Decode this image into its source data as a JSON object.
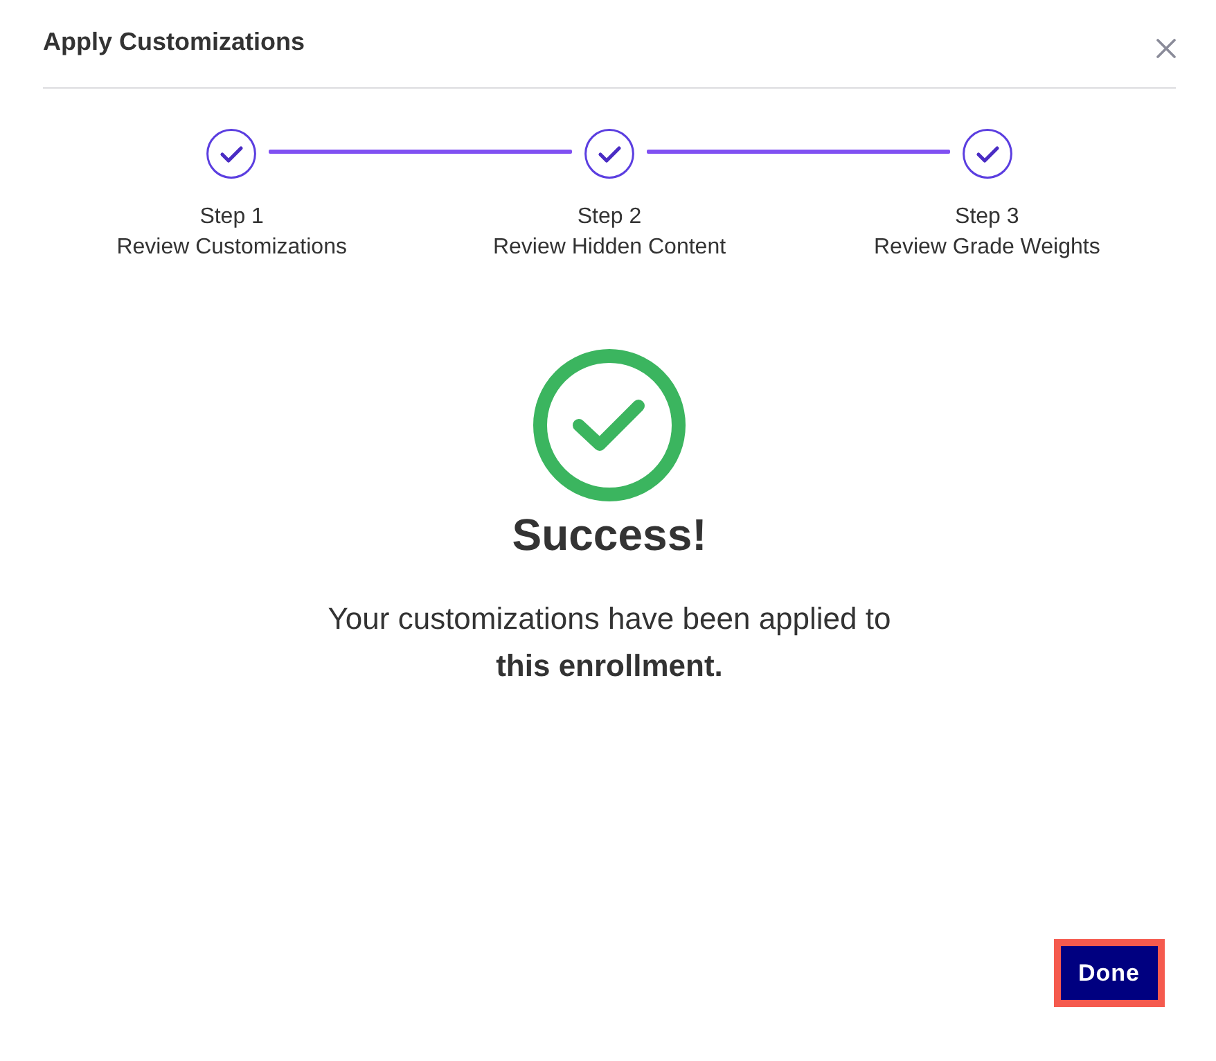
{
  "dialog": {
    "title": "Apply Customizations"
  },
  "steps": [
    {
      "number_label": "Step 1",
      "title": "Review Customizations",
      "completed": true
    },
    {
      "number_label": "Step 2",
      "title": "Review Hidden Content",
      "completed": true
    },
    {
      "number_label": "Step 3",
      "title": "Review Grade Weights",
      "completed": true
    }
  ],
  "result": {
    "kind": "success",
    "heading": "Success!",
    "message": "Your customizations have been applied to **this enrollment.**"
  },
  "buttons": [
    {
      "label": "Done",
      "focused": true
    }
  ]
}
